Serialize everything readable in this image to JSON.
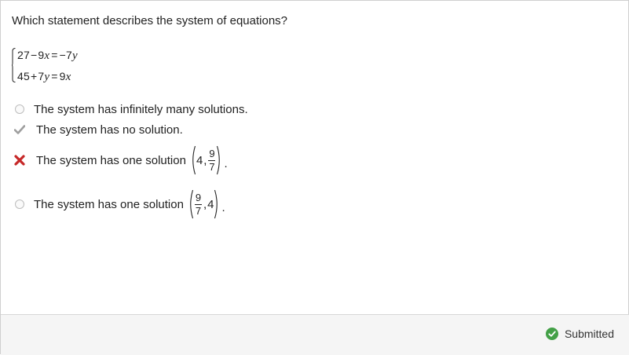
{
  "question": {
    "prompt": "Which statement describes the system of equations?",
    "equations": {
      "eq1": {
        "lhs_a": "27",
        "lhs_op": "−",
        "lhs_b": "9",
        "lhs_var": "x",
        "eq": "=",
        "rhs_sign": "−",
        "rhs_coef": "7",
        "rhs_var": "y"
      },
      "eq2": {
        "lhs_a": "45",
        "lhs_op": "+",
        "lhs_b": "7",
        "lhs_var": "y",
        "eq": "=",
        "rhs_coef": "9",
        "rhs_var": "x"
      }
    }
  },
  "options": [
    {
      "text": "The system has infinitely many solutions.",
      "marker": "radio-empty"
    },
    {
      "text": "The system has no solution.",
      "marker": "check-icon",
      "marker_color": "#9e9e9e"
    },
    {
      "text": "The system has one solution",
      "marker": "x-icon",
      "marker_color": "#c62828",
      "math": {
        "first": "4",
        "second_num": "9",
        "second_den": "7",
        "period": "."
      }
    },
    {
      "text": "The system has one solution",
      "marker": "radio-empty",
      "math": {
        "first_num": "9",
        "first_den": "7",
        "second": "4",
        "period": "."
      }
    }
  ],
  "footer": {
    "status_text": "Submitted",
    "status_icon": "check-circle-icon",
    "status_color": "#43a047"
  }
}
